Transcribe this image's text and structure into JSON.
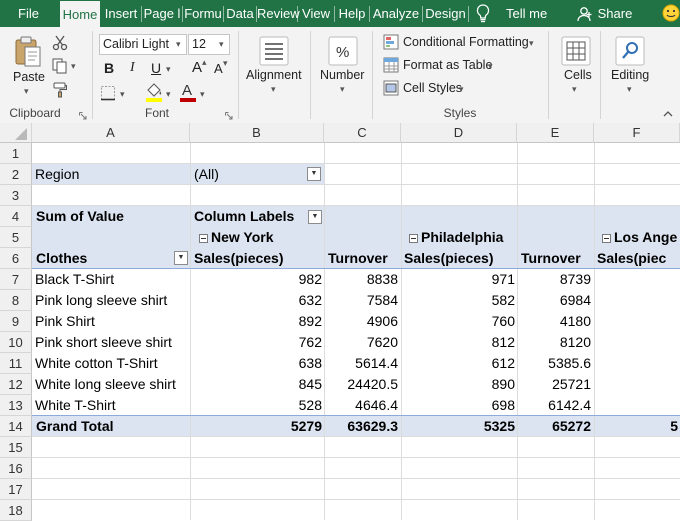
{
  "tabs": [
    "File",
    "Home",
    "Insert",
    "Page l",
    "Formu",
    "Data",
    "Review",
    "View",
    "Help",
    "Analyze",
    "Design"
  ],
  "active_tab": "Home",
  "tell_me": "Tell me",
  "share": "Share",
  "ribbon": {
    "clipboard": {
      "paste": "Paste",
      "label": "Clipboard"
    },
    "font": {
      "name": "Calibri Light",
      "size": "12",
      "label": "Font",
      "bold": "B",
      "italic": "I",
      "underline": "U",
      "grow": "A",
      "shrink": "A"
    },
    "alignment": {
      "label": "Alignment"
    },
    "number": {
      "label": "Number",
      "symbol": "%"
    },
    "styles": {
      "conditional": "Conditional Formatting",
      "format_table": "Format as Table",
      "cell_styles": "Cell Styles",
      "label": "Styles"
    },
    "cells": {
      "label": "Cells"
    },
    "editing": {
      "label": "Editing"
    }
  },
  "columns": [
    "A",
    "B",
    "C",
    "D",
    "E",
    "F"
  ],
  "rows": [
    "1",
    "2",
    "3",
    "4",
    "5",
    "6",
    "7",
    "8",
    "9",
    "10",
    "11",
    "12",
    "13",
    "14",
    "15",
    "16",
    "17",
    "18"
  ],
  "pivot": {
    "filter_label": "Region",
    "filter_value": "(All)",
    "values_label": "Sum of Value",
    "column_labels": "Column Labels",
    "row_field": "Clothes",
    "cities": [
      "New York",
      "Philadelphia",
      "Los Ange"
    ],
    "headers": [
      "Sales(pieces)",
      "Turnover",
      "Sales(pieces)",
      "Turnover",
      "Sales(piec"
    ],
    "data": [
      {
        "item": "Black T-Shirt",
        "v": [
          "982",
          "8838",
          "971",
          "8739"
        ]
      },
      {
        "item": "Pink long sleeve shirt",
        "v": [
          "632",
          "7584",
          "582",
          "6984"
        ]
      },
      {
        "item": "Pink Shirt",
        "v": [
          "892",
          "4906",
          "760",
          "4180"
        ]
      },
      {
        "item": "Pink short sleeve shirt",
        "v": [
          "762",
          "7620",
          "812",
          "8120"
        ]
      },
      {
        "item": "White cotton T-Shirt",
        "v": [
          "638",
          "5614.4",
          "612",
          "5385.6"
        ]
      },
      {
        "item": "White long sleeve shirt",
        "v": [
          "845",
          "24420.5",
          "890",
          "25721"
        ]
      },
      {
        "item": "White T-Shirt",
        "v": [
          "528",
          "4646.4",
          "698",
          "6142.4"
        ]
      }
    ],
    "grand_total": {
      "label": "Grand Total",
      "v": [
        "5279",
        "63629.3",
        "5325",
        "65272",
        "5"
      ]
    }
  },
  "colors": {
    "accent": "#217346",
    "pivot_band": "#dde4f1",
    "font_color_bar": "#c00000",
    "highlight_bar": "#ffff00"
  }
}
